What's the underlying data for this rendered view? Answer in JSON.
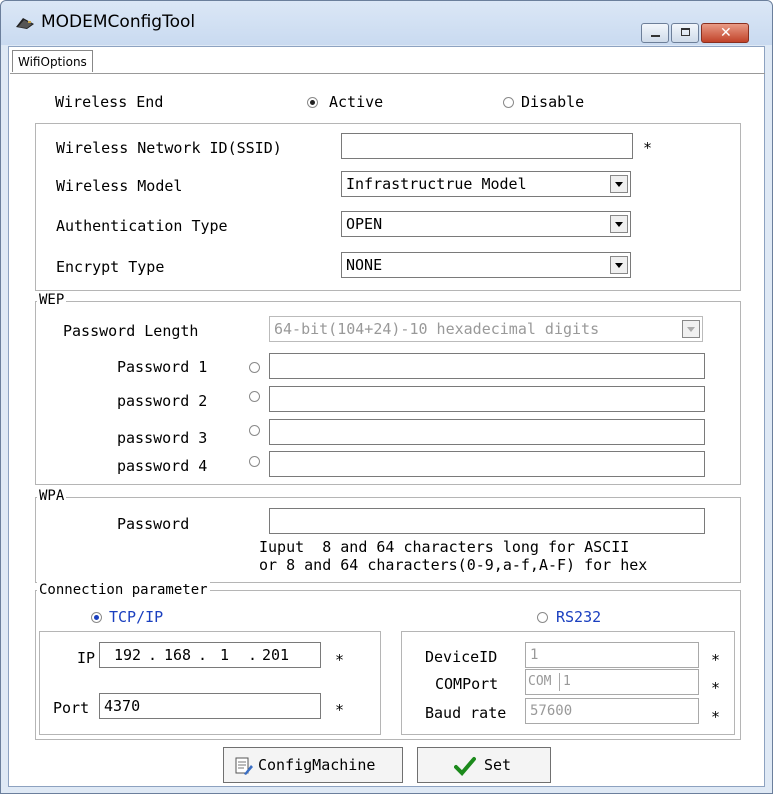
{
  "window": {
    "title": "MODEMConfigTool",
    "icon": "modem-app-icon"
  },
  "tab": {
    "label": "WifiOptions"
  },
  "wireless_end": {
    "label": "Wireless End",
    "active_label": "Active",
    "disable_label": "Disable",
    "selected": "Active"
  },
  "basic": {
    "ssid_label": "Wireless Network ID(SSID)",
    "ssid_value": "",
    "required": "*",
    "model_label": "Wireless Model",
    "model_value": "Infrastructrue Model",
    "auth_label": "Authentication Type",
    "auth_value": "OPEN",
    "encrypt_label": "Encrypt Type",
    "encrypt_value": "NONE"
  },
  "wep": {
    "title": "WEP",
    "length_label": "Password Length",
    "length_value": "64-bit(104+24)-10 hexadecimal digits",
    "passwords": [
      {
        "label": "Password 1",
        "value": ""
      },
      {
        "label": "password 2",
        "value": ""
      },
      {
        "label": "password 3",
        "value": ""
      },
      {
        "label": "password 4",
        "value": ""
      }
    ]
  },
  "wpa": {
    "title": "WPA",
    "password_label": "Password",
    "password_value": "",
    "hint_line1": "Iuput  8 and 64 characters long for ASCII",
    "hint_line2": "or 8 and 64 characters(0-9,a-f,A-F) for hex"
  },
  "connection": {
    "title": "Connection parameter",
    "tcp_label": "TCP/IP",
    "rs232_label": "RS232",
    "selected": "TCP/IP",
    "ip_label": "IP",
    "ip_octets": [
      "192",
      "168",
      "1",
      "201"
    ],
    "ip_dot": ".",
    "port_label": "Port",
    "port_value": "4370",
    "device_id_label": "DeviceID",
    "device_id_value": "1",
    "comport_label": "COMPort",
    "comport_prefix": "COM",
    "comport_value": "1",
    "baud_label": "Baud rate",
    "baud_value": "57600",
    "required": "*"
  },
  "buttons": {
    "config_machine": "ConfigMachine",
    "set": "Set"
  },
  "colors": {
    "titlebar": "#c9daf0",
    "accent_blue": "#1a3fbf",
    "close_red": "#c1432a",
    "check_green": "#1c8a1c"
  }
}
